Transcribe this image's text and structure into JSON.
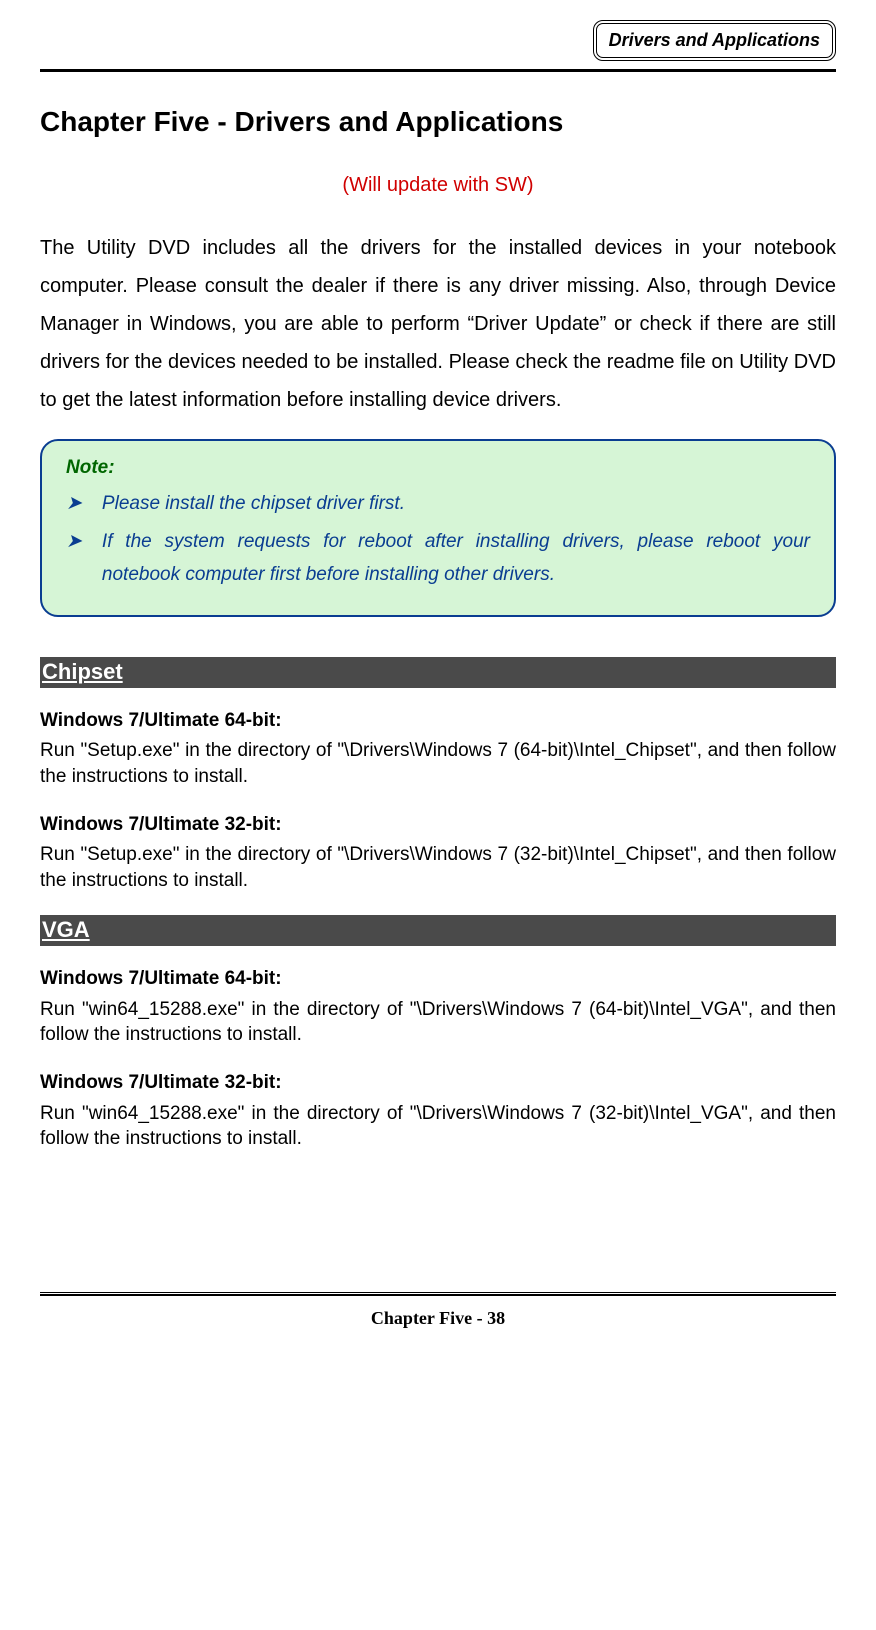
{
  "header": {
    "badge": "Drivers and Applications"
  },
  "chapter": {
    "title": "Chapter Five - Drivers and Applications",
    "update_note": "(Will update with SW)",
    "intro": "The Utility DVD includes all the drivers for the installed devices in your notebook computer. Please consult the dealer if there is any driver missing. Also, through Device Manager in Windows, you are able to perform “Driver Update” or check if there are still drivers for the devices needed to be installed. Please check the readme file on Utility DVD to get the latest information before installing device drivers."
  },
  "note": {
    "label": "Note:",
    "items": [
      "Please install the chipset driver first.",
      "If the system requests for reboot after installing drivers, please reboot your notebook computer first before installing other drivers."
    ]
  },
  "sections": [
    {
      "title": "Chipset",
      "entries": [
        {
          "heading": "Windows 7/Ultimate 64-bit:",
          "body": "Run \"Setup.exe\" in the directory of \"\\Drivers\\Windows 7 (64-bit)\\Intel_Chipset\", and then follow the instructions to install."
        },
        {
          "heading": "Windows 7/Ultimate 32-bit:",
          "body": "Run \"Setup.exe\" in the directory of \"\\Drivers\\Windows 7 (32-bit)\\Intel_Chipset\", and then follow the instructions to install."
        }
      ]
    },
    {
      "title": "VGA",
      "entries": [
        {
          "heading": "Windows 7/Ultimate 64-bit:",
          "body": "Run \"win64_15288.exe\" in the directory of \"\\Drivers\\Windows 7 (64-bit)\\Intel_VGA\", and then follow the instructions to install."
        },
        {
          "heading": "Windows 7/Ultimate 32-bit:",
          "body": "Run \"win64_15288.exe\" in the directory of \"\\Drivers\\Windows 7 (32-bit)\\Intel_VGA\", and then follow the instructions to install."
        }
      ]
    }
  ],
  "footer": {
    "text": "Chapter Five - 38"
  }
}
